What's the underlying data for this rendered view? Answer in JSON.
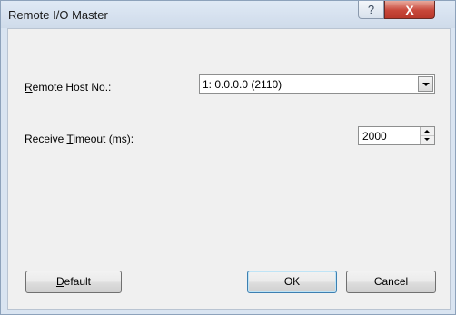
{
  "window": {
    "title": "Remote I/O Master",
    "help_glyph": "?",
    "close_glyph": "X"
  },
  "form": {
    "remote_host": {
      "label_access_key": "R",
      "label_rest": "emote Host No.:",
      "selected_value": "1: 0.0.0.0 (2110)"
    },
    "receive_timeout": {
      "label_prefix": "Receive ",
      "label_access_key": "T",
      "label_rest": "imeout (ms):",
      "value": "2000"
    }
  },
  "buttons": {
    "default": {
      "access_key": "D",
      "rest": "efault"
    },
    "ok": "OK",
    "cancel": "Cancel"
  },
  "icons": [
    "help-icon",
    "close-icon",
    "dropdown-arrow-icon",
    "spin-up-icon",
    "spin-down-icon"
  ]
}
